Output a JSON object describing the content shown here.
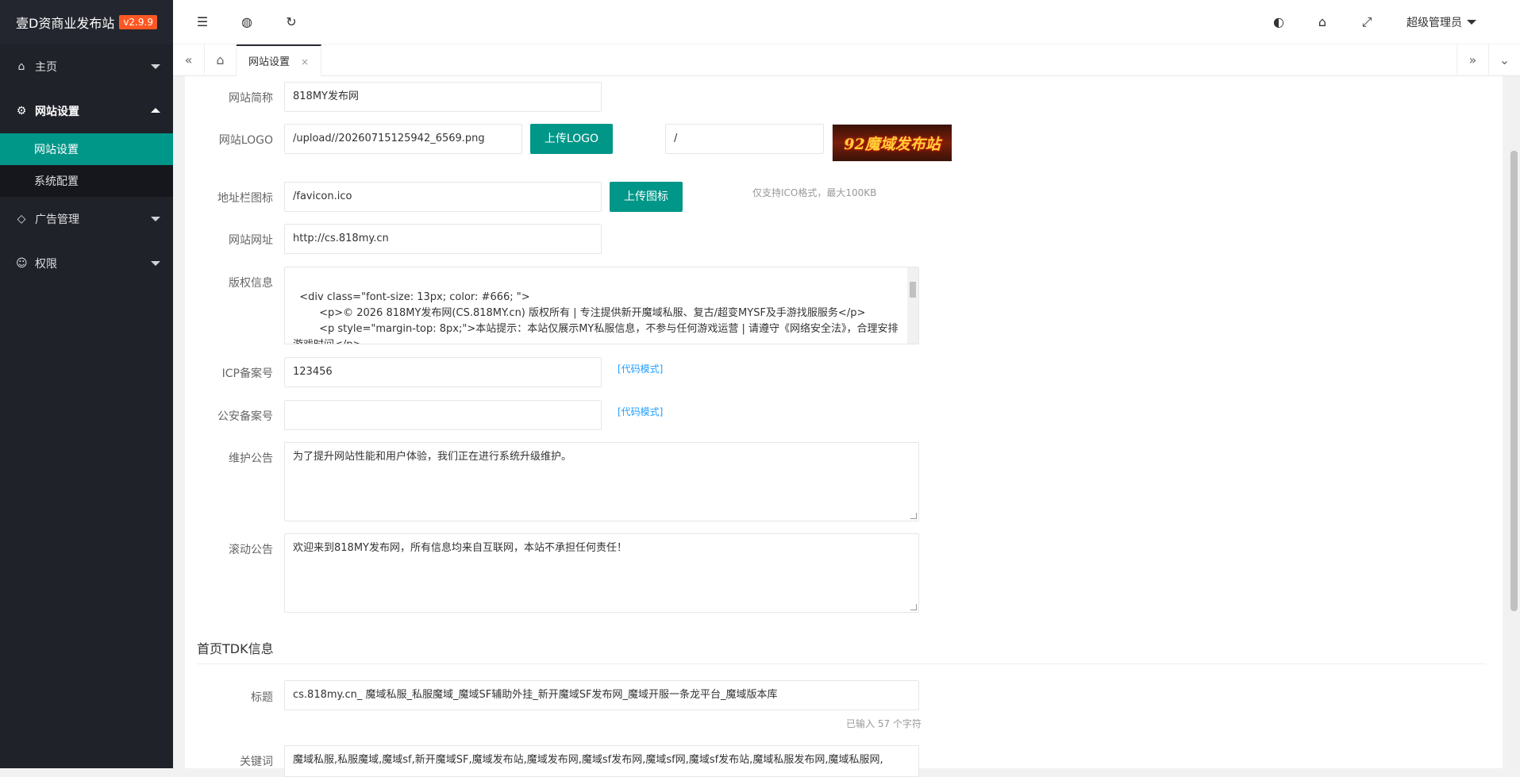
{
  "brand": {
    "name": "壹D资商业发布站",
    "version": "v2.9.9"
  },
  "sidebar": {
    "items": [
      {
        "label": "主页",
        "icon": "home-icon"
      },
      {
        "label": "网站设置",
        "icon": "gear-icon"
      },
      {
        "label": "广告管理",
        "icon": "diamond-icon"
      },
      {
        "label": "权限",
        "icon": "user-icon"
      }
    ],
    "sub": [
      {
        "label": "网站设置"
      },
      {
        "label": "系统配置"
      }
    ]
  },
  "topbar": {
    "user": "超级管理员"
  },
  "tabs": {
    "active": "网站设置",
    "close": "×"
  },
  "form": {
    "site_short_name": {
      "label": "网站简称",
      "value": "818MY发布网"
    },
    "site_logo": {
      "label": "网站LOGO",
      "value": "/upload//20260715125942_6569.png",
      "button": "上传LOGO",
      "second_value": "/",
      "logo_text": "92魔域发布站"
    },
    "favicon": {
      "label": "地址栏图标",
      "value": "/favicon.ico",
      "button": "上传图标",
      "hint": "仅支持ICO格式，最大100KB"
    },
    "site_url": {
      "label": "网站网址",
      "value": "http://cs.818my.cn"
    },
    "copyright": {
      "label": "版权信息",
      "value": "<div class=\"font-size: 13px; color: #666; \">\n        <p>© 2026 818MY发布网(CS.818MY.cn) 版权所有 | 专注提供新开魔域私服、复古/超变MYSF及手游找服服务</p>\n        <p style=\"margin-top: 8px;\">本站提示：本站仅展示MY私服信息，不参与任何游戏运营 | 请遵守《网络安全法》，合理安排游戏时间</p>\n    </div>"
    },
    "icp": {
      "label": "ICP备案号",
      "value": "123456",
      "link": "[代码模式]"
    },
    "police": {
      "label": "公安备案号",
      "value": "",
      "link": "[代码模式]"
    },
    "maintenance": {
      "label": "维护公告",
      "value": "为了提升网站性能和用户体验，我们正在进行系统升级维护。"
    },
    "scroll_notice": {
      "label": "滚动公告",
      "value": "欢迎来到818MY发布网，所有信息均来自互联网，本站不承担任何责任！"
    }
  },
  "tdk": {
    "section_title": "首页TDK信息",
    "title": {
      "label": "标题",
      "value": "cs.818my.cn_ 魔域私服_私服魔域_魔域SF辅助外挂_新开魔域SF发布网_魔域开服一条龙平台_魔域版本库",
      "count": "已输入 57 个字符"
    },
    "keywords": {
      "label": "关键词",
      "value": "魔域私服,私服魔域,魔域sf,新开魔域SF,魔域发布站,魔域发布网,魔域sf发布网,魔域sf网,魔域sf发布站,魔域私服发布网,魔域私服网,"
    }
  },
  "colors": {
    "accent": "#009688",
    "sidebar": "#20222a",
    "version_badge": "#ff5722",
    "link": "#1e9fff"
  }
}
